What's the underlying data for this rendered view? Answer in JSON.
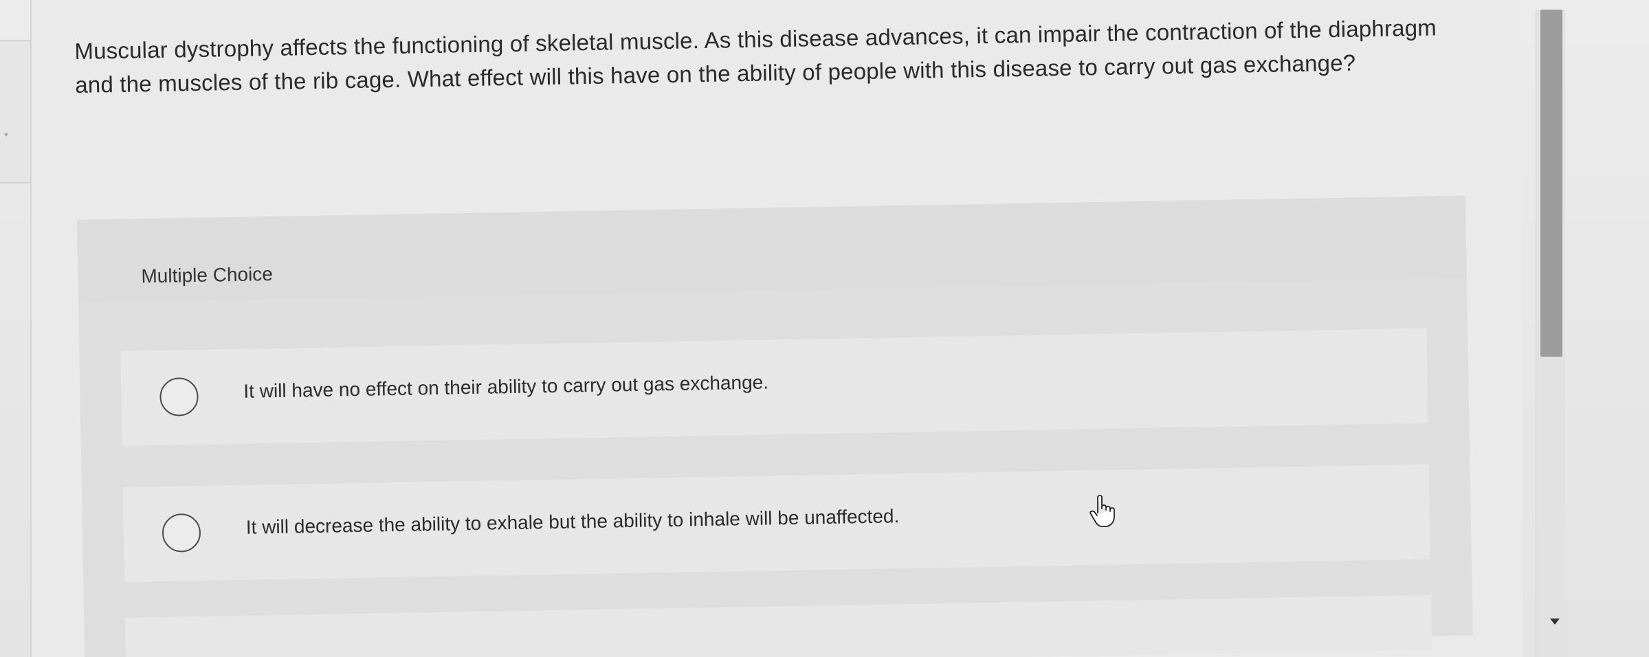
{
  "question": {
    "text": "Muscular dystrophy affects the functioning of skeletal muscle. As this disease advances, it can impair the contraction of the diaphragm and the muscles of the rib cage. What effect will this have on the ability of people with this disease to carry out gas exchange?"
  },
  "multiple_choice": {
    "label": "Multiple Choice",
    "options": [
      {
        "text": "It will have no effect on their ability to carry out gas exchange.",
        "selected": false
      },
      {
        "text": "It will decrease the ability to exhale but the ability to inhale will be unaffected.",
        "selected": false
      }
    ]
  },
  "icons": {
    "radio": "radio-unselected-icon",
    "cursor": "hand-pointer-icon",
    "scroll_down": "chevron-down-icon"
  },
  "colors": {
    "background": "#eaeaea",
    "text": "#2a2a2a",
    "scroll_thumb": "#9c9c9c"
  }
}
